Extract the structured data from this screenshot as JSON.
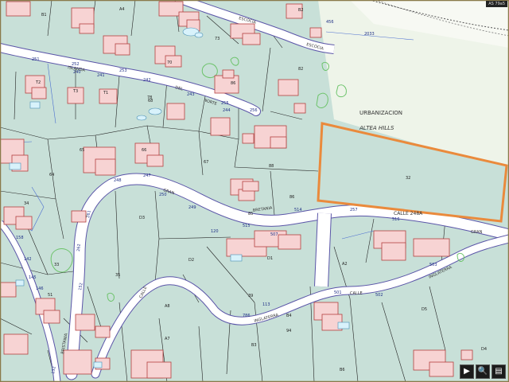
{
  "colors": {
    "parcel_fill": "#c8e0d8",
    "road_fill": "#ffffff",
    "road_edge": "#5a55a8",
    "building_fill": "#f7d3d3",
    "building_edge": "#b5403f",
    "highlight": "#ea8a3c",
    "pool": "#d8f2fb",
    "vegetation": "#6cc36a",
    "urbanization_area": "#f3f7ee"
  },
  "map": {
    "labels": {
      "urbanizacion": "URBANIZACION",
      "altea_hills": "ALTEA HILLS",
      "calle_248a": "CALLE  248A",
      "calle_left": "CALLE",
      "gran": "GRAN",
      "gran_2": "GRAN",
      "bristania": "BRISTANIA",
      "bretania": "BRETANIA",
      "inglaterra": "INGLATERRA",
      "calle_low": "CALLE",
      "inglaterra_2": "INGLATERRA",
      "calle_islanda": "ISLANDA",
      "calle_del": "DEL",
      "norte": "NORTE",
      "escocia_top": "ESCOCIA",
      "escocia_2": "ESCOCIA",
      "num_257": "257",
      "num_515": "515",
      "num_516": "516",
      "num_514": "514",
      "num_513": "513",
      "num_247": "247",
      "num_249": "249",
      "num_248": "248",
      "num_250": "250",
      "num_120": "120",
      "num_502": "502",
      "num_503": "503",
      "num_507": "507",
      "num_501": "501",
      "num_244": "244",
      "num_243": "243",
      "num_242": "242",
      "num_241": "241",
      "num_240": "240",
      "num_251": "251",
      "num_252": "252",
      "num_253": "253",
      "num_255": "255",
      "num_256": "256",
      "num_261": "261",
      "num_262": "262",
      "num_158": "158",
      "num_142": "142",
      "num_145": "145",
      "num_146": "146",
      "num_152": "152",
      "num_113": "113",
      "num_786": "786",
      "num_132": "132",
      "num_2033": "2033",
      "num_456": "456",
      "parcel_32": "32",
      "parcel_A4": "A4",
      "parcel_B1": "B1",
      "parcel_B2": "B2",
      "parcel_65": "65",
      "parcel_64": "64",
      "parcel_67": "67",
      "parcel_66": "66",
      "parcel_68": "68",
      "parcel_D3": "D3",
      "parcel_D2": "D2",
      "parcel_D1": "D1",
      "parcel_A2": "A2",
      "parcel_A8": "A8",
      "parcel_A7": "A7",
      "parcel_B3": "B3",
      "parcel_B4": "B4",
      "parcel_B6": "B6",
      "parcel_D5": "D5",
      "parcel_D4": "D4",
      "parcel_39": "39",
      "parcel_94": "94",
      "parcel_33": "33",
      "parcel_34": "34",
      "parcel_35": "35",
      "parcel_51": "51",
      "parcel_85": "85",
      "parcel_86": "86",
      "parcel_88": "88",
      "parcel_T1": "T1",
      "parcel_T2": "T2",
      "parcel_T3": "T3",
      "parcel_70": "70",
      "parcel_73": "73",
      "parcel_78": "78",
      "parcel_82": "82",
      "parcel_86b": "86"
    },
    "badge": "AS 79a5"
  },
  "toolbar": {
    "next_label": "▶",
    "zoom_label": "🔍",
    "layers_label": "▤"
  }
}
